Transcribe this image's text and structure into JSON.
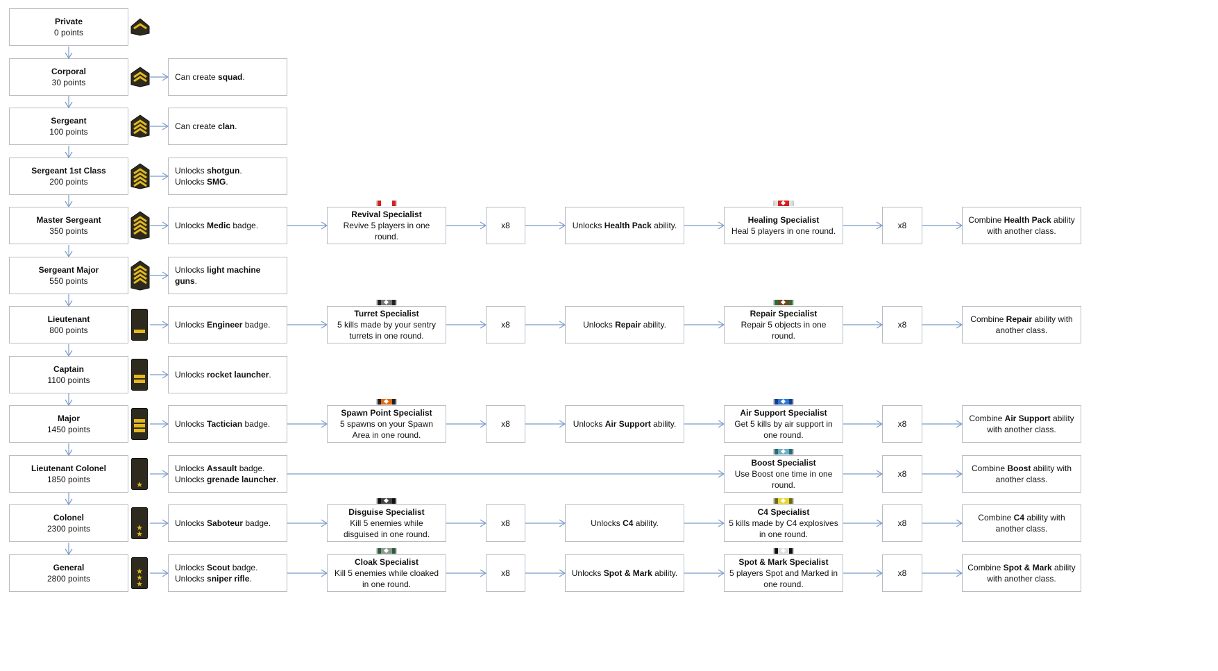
{
  "colors": {
    "arrow": "#7a9bc8",
    "border": "#b8bcc2",
    "badge_gold": "#e2b81e",
    "badge_dark": "#2e2a1e"
  },
  "rows": [
    {
      "rank": "Private",
      "points": "0 points",
      "badge": {
        "type": "chevron",
        "count": 1
      }
    },
    {
      "rank": "Corporal",
      "points": "30 points",
      "badge": {
        "type": "chevron",
        "count": 2
      },
      "unlock": [
        [
          {
            "t": "Can create "
          },
          {
            "t": "squad",
            "b": true
          },
          {
            "t": "."
          }
        ]
      ]
    },
    {
      "rank": "Sergeant",
      "points": "100 points",
      "badge": {
        "type": "chevron",
        "count": 3
      },
      "unlock": [
        [
          {
            "t": "Can create "
          },
          {
            "t": "clan",
            "b": true
          },
          {
            "t": "."
          }
        ]
      ]
    },
    {
      "rank": "Sergeant 1st Class",
      "points": "200 points",
      "badge": {
        "type": "chevron",
        "count": 4
      },
      "unlock": [
        [
          {
            "t": "Unlocks "
          },
          {
            "t": "shotgun",
            "b": true
          },
          {
            "t": "."
          }
        ],
        [
          {
            "t": "Unlocks "
          },
          {
            "t": "SMG",
            "b": true
          },
          {
            "t": "."
          }
        ]
      ]
    },
    {
      "rank": "Master Sergeant",
      "points": "350 points",
      "badge": {
        "type": "chevron",
        "count": 5
      },
      "unlock": [
        [
          {
            "t": "Unlocks "
          },
          {
            "t": "Medic",
            "b": true
          },
          {
            "t": " badge."
          }
        ]
      ],
      "spec1": {
        "title": "Revival Specialist",
        "desc": "Revive 5 players in one round.",
        "ribbon": [
          "#d81e1e",
          "#ffffff",
          "#d81e1e"
        ]
      },
      "mult1": "x8",
      "ability": [
        [
          {
            "t": "Unlocks "
          },
          {
            "t": "Health Pack",
            "b": true
          },
          {
            "t": " ability."
          }
        ]
      ],
      "spec2": {
        "title": "Healing Specialist",
        "desc": "Heal 5 players in one round.",
        "ribbon": [
          "#e0e0e0",
          "#d81e1e",
          "#e0e0e0"
        ]
      },
      "mult2": "x8",
      "combine": [
        [
          {
            "t": "Combine "
          },
          {
            "t": "Health Pack",
            "b": true
          },
          {
            "t": " ability with another class."
          }
        ]
      ]
    },
    {
      "rank": "Sergeant Major",
      "points": "550 points",
      "badge": {
        "type": "chevron",
        "count": 6
      },
      "unlock": [
        [
          {
            "t": "Unlocks "
          },
          {
            "t": "light machine guns",
            "b": true
          },
          {
            "t": "."
          }
        ]
      ]
    },
    {
      "rank": "Lieutenant",
      "points": "800 points",
      "badge": {
        "type": "bar",
        "count": 1
      },
      "unlock": [
        [
          {
            "t": "Unlocks "
          },
          {
            "t": "Engineer",
            "b": true
          },
          {
            "t": " badge."
          }
        ]
      ],
      "spec1": {
        "title": "Turret Specialist",
        "desc": "5 kills made by your sentry turrets in one round.",
        "ribbon": [
          "#222222",
          "#777777",
          "#222222"
        ]
      },
      "mult1": "x8",
      "ability": [
        [
          {
            "t": "Unlocks "
          },
          {
            "t": "Repair",
            "b": true
          },
          {
            "t": " ability."
          }
        ]
      ],
      "spec2": {
        "title": "Repair Specialist",
        "desc": "Repair 5 objects in one round.",
        "ribbon": [
          "#2f6a3a",
          "#6b4a1e",
          "#2f6a3a"
        ]
      },
      "mult2": "x8",
      "combine": [
        [
          {
            "t": "Combine "
          },
          {
            "t": "Repair",
            "b": true
          },
          {
            "t": " ability with another class."
          }
        ]
      ]
    },
    {
      "rank": "Captain",
      "points": "1100 points",
      "badge": {
        "type": "bar",
        "count": 2
      },
      "unlock": [
        [
          {
            "t": "Unlocks "
          },
          {
            "t": "rocket launcher",
            "b": true
          },
          {
            "t": "."
          }
        ]
      ]
    },
    {
      "rank": "Major",
      "points": "1450 points",
      "badge": {
        "type": "bar",
        "count": 3
      },
      "unlock": [
        [
          {
            "t": "Unlocks "
          },
          {
            "t": "Tactician",
            "b": true
          },
          {
            "t": " badge."
          }
        ]
      ],
      "spec1": {
        "title": "Spawn Point Specialist",
        "desc": "5 spawns on your Spawn Area in one round.",
        "ribbon": [
          "#222222",
          "#e06a10",
          "#222222"
        ]
      },
      "mult1": "x8",
      "ability": [
        [
          {
            "t": "Unlocks "
          },
          {
            "t": "Air Support",
            "b": true
          },
          {
            "t": " ability."
          }
        ]
      ],
      "spec2": {
        "title": "Air Support Specialist",
        "desc": "Get 5 kills by air support in one round.",
        "ribbon": [
          "#1a3a8a",
          "#2a78d8",
          "#1a3a8a"
        ]
      },
      "mult2": "x8",
      "combine": [
        [
          {
            "t": "Combine "
          },
          {
            "t": "Air Support",
            "b": true
          },
          {
            "t": " ability with another class."
          }
        ]
      ]
    },
    {
      "rank": "Lieutenant Colonel",
      "points": "1850 points",
      "badge": {
        "type": "star",
        "count": 1
      },
      "unlock": [
        [
          {
            "t": "Unlocks "
          },
          {
            "t": "Assault",
            "b": true
          },
          {
            "t": " badge."
          }
        ],
        [
          {
            "t": "Unlocks "
          },
          {
            "t": "grenade launcher",
            "b": true
          },
          {
            "t": "."
          }
        ]
      ],
      "spec2": {
        "title": "Boost Specialist",
        "desc": "Use Boost one time in one round.",
        "ribbon": [
          "#2a6a78",
          "#6ab0c0",
          "#2a6a78"
        ]
      },
      "mult2": "x8",
      "combine": [
        [
          {
            "t": "Combine "
          },
          {
            "t": "Boost",
            "b": true
          },
          {
            "t": " ability with another class."
          }
        ]
      ]
    },
    {
      "rank": "Colonel",
      "points": "2300 points",
      "badge": {
        "type": "star",
        "count": 2
      },
      "unlock": [
        [
          {
            "t": "Unlocks "
          },
          {
            "t": "Saboteur",
            "b": true
          },
          {
            "t": " badge."
          }
        ]
      ],
      "spec1": {
        "title": "Disguise Specialist",
        "desc": "Kill 5 enemies while disguised in one round.",
        "ribbon": [
          "#111111",
          "#444444",
          "#111111"
        ]
      },
      "mult1": "x8",
      "ability": [
        [
          {
            "t": "Unlocks "
          },
          {
            "t": "C4",
            "b": true
          },
          {
            "t": " ability."
          }
        ]
      ],
      "spec2": {
        "title": "C4 Specialist",
        "desc": "5 kills made by C4 explosives in one round.",
        "ribbon": [
          "#6a6a20",
          "#e6d830",
          "#6a6a20"
        ]
      },
      "mult2": "x8",
      "combine": [
        [
          {
            "t": "Combine "
          },
          {
            "t": "C4",
            "b": true
          },
          {
            "t": " ability with another class."
          }
        ]
      ]
    },
    {
      "rank": "General",
      "points": "2800 points",
      "badge": {
        "type": "star",
        "count": 3
      },
      "unlock": [
        [
          {
            "t": "Unlocks "
          },
          {
            "t": "Scout",
            "b": true
          },
          {
            "t": " badge."
          }
        ],
        [
          {
            "t": "Unlocks "
          },
          {
            "t": "sniper rifle",
            "b": true
          },
          {
            "t": "."
          }
        ]
      ],
      "spec1": {
        "title": "Cloak Specialist",
        "desc": "Kill 5 enemies while cloaked in one round.",
        "ribbon": [
          "#2f5a3a",
          "#889890",
          "#2f5a3a"
        ]
      },
      "mult1": "x8",
      "ability": [
        [
          {
            "t": "Unlocks "
          },
          {
            "t": "Spot & Mark",
            "b": true
          },
          {
            "t": " ability."
          }
        ]
      ],
      "spec2": {
        "title": "Spot & Mark Specialist",
        "desc": "5 players Spot and Marked in one round.",
        "ribbon": [
          "#111111",
          "#dddddd",
          "#111111"
        ]
      },
      "mult2": "x8",
      "combine": [
        [
          {
            "t": "Combine "
          },
          {
            "t": "Spot & Mark",
            "b": true
          },
          {
            "t": " ability with another class."
          }
        ]
      ]
    }
  ]
}
